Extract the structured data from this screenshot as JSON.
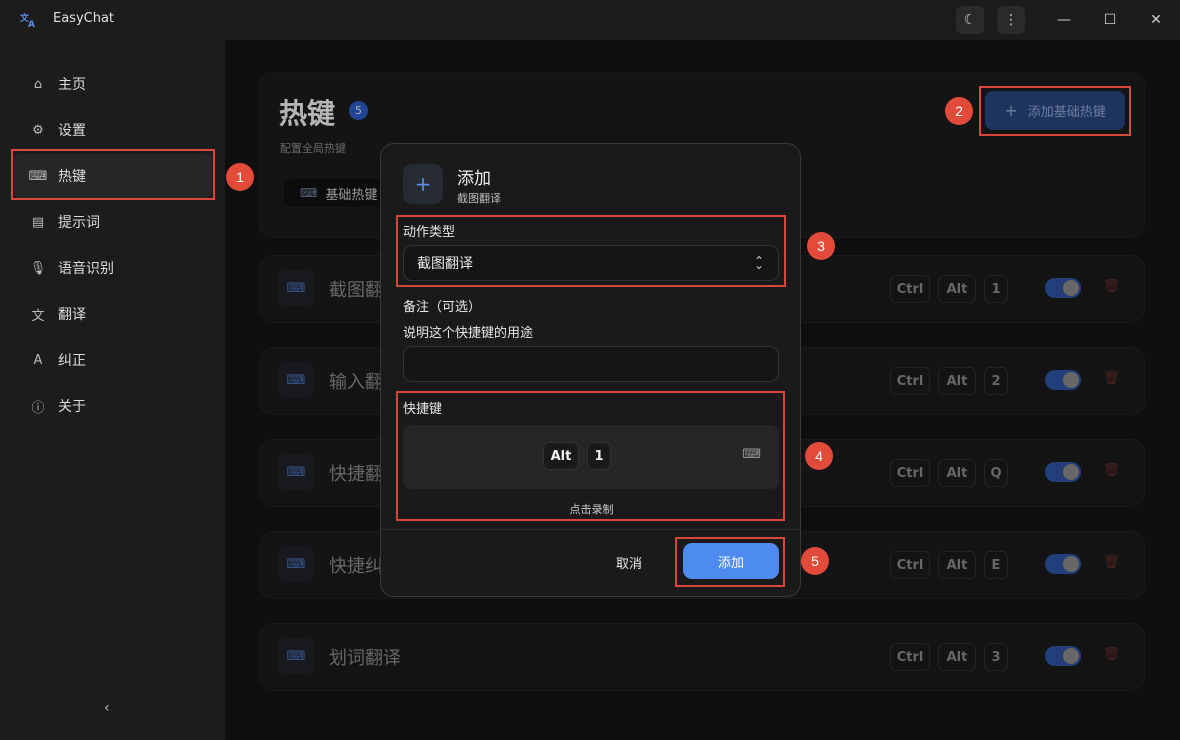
{
  "app": {
    "title": "EasyChat",
    "logo_icon": "translate-icon"
  },
  "titlebar": {
    "buttons": [
      "moon-icon",
      "more-vertical-icon",
      "minimize-icon",
      "maximize-icon",
      "close-icon"
    ]
  },
  "sidebar": {
    "items": [
      {
        "label": "主页",
        "icon": "home-icon"
      },
      {
        "label": "设置",
        "icon": "gear-icon"
      },
      {
        "label": "热键",
        "icon": "keyboard-icon",
        "active": true
      },
      {
        "label": "提示词",
        "icon": "document-icon"
      },
      {
        "label": "语音识别",
        "icon": "microphone-icon"
      },
      {
        "label": "翻译",
        "icon": "translate-icon"
      },
      {
        "label": "纠正",
        "icon": "spellcheck-icon"
      },
      {
        "label": "关于",
        "icon": "info-icon"
      }
    ],
    "collapse_icon": "chevron-left-icon"
  },
  "page": {
    "title": "热键",
    "count": "5",
    "subtitle": "配置全局热键",
    "tab_basic": "基础热键",
    "add_basic_button": "添加基础热键"
  },
  "hotkeys": [
    {
      "name": "截图翻译",
      "keys": [
        "Ctrl",
        "Alt",
        "1"
      ],
      "enabled": true
    },
    {
      "name": "输入翻译",
      "keys": [
        "Ctrl",
        "Alt",
        "2"
      ],
      "enabled": true
    },
    {
      "name": "快捷翻译",
      "keys": [
        "Ctrl",
        "Alt",
        "Q"
      ],
      "enabled": true
    },
    {
      "name": "快捷纠正",
      "keys": [
        "Ctrl",
        "Alt",
        "E"
      ],
      "enabled": true
    },
    {
      "name": "划词翻译",
      "keys": [
        "Ctrl",
        "Alt",
        "3"
      ],
      "enabled": true
    }
  ],
  "modal": {
    "title": "添加",
    "subtitle": "截图翻译",
    "action_type_label": "动作类型",
    "action_type_value": "截图翻译",
    "note_label": "备注（可选）",
    "note_hint": "说明这个快捷键的用途",
    "note_value": "",
    "shortcut_label": "快捷键",
    "shortcut_keys": [
      "Alt",
      "1"
    ],
    "record_hint": "点击录制",
    "cancel_label": "取消",
    "submit_label": "添加"
  },
  "annotations": [
    "1",
    "2",
    "3",
    "4",
    "5"
  ],
  "colors": {
    "accent": "#4d8bf0",
    "annotation": "#e24a3a",
    "background": "#141414"
  }
}
